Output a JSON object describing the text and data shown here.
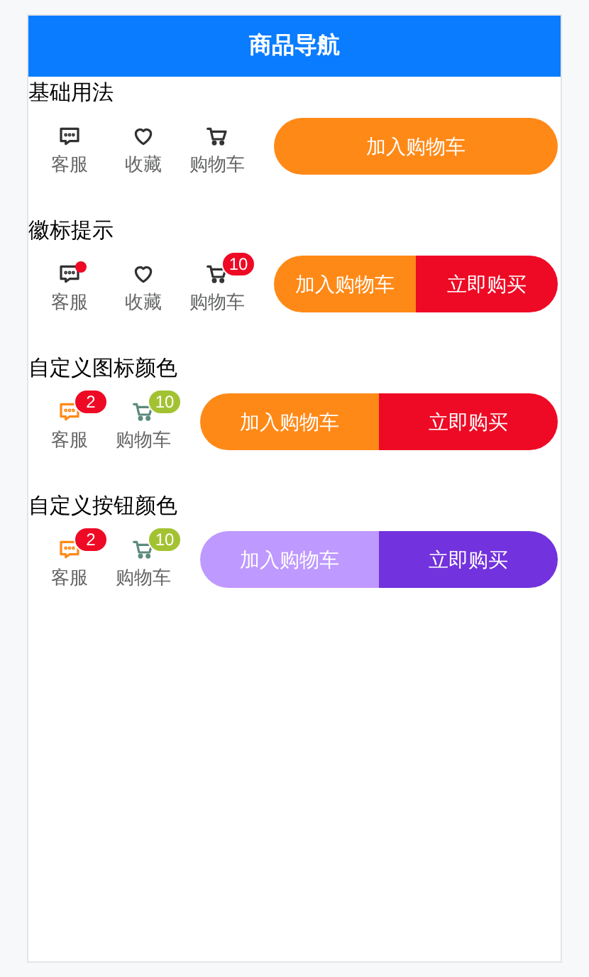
{
  "header": {
    "title": "商品导航"
  },
  "sections": [
    {
      "title": "基础用法",
      "icons": [
        {
          "kind": "chat",
          "label": "客服"
        },
        {
          "kind": "heart",
          "label": "收藏"
        },
        {
          "kind": "cart",
          "label": "购物车"
        }
      ],
      "buttons": [
        {
          "label": "加入购物车",
          "color": "#ff8917"
        }
      ]
    },
    {
      "title": "徽标提示",
      "icons": [
        {
          "kind": "chat",
          "label": "客服",
          "badge": {
            "kind": "dot",
            "color": "#ee0a24"
          }
        },
        {
          "kind": "heart",
          "label": "收藏"
        },
        {
          "kind": "cart",
          "label": "购物车",
          "badge": {
            "kind": "count",
            "text": "10",
            "color": "#ee0a24"
          }
        }
      ],
      "buttons": [
        {
          "label": "加入购物车",
          "color": "#ff8917"
        },
        {
          "label": "立即购买",
          "color": "#ee0a24"
        }
      ]
    },
    {
      "title": "自定义图标颜色",
      "icons": [
        {
          "kind": "chat",
          "label": "客服",
          "color": "#ff8917",
          "badge": {
            "kind": "count",
            "text": "2",
            "color": "#ee0a24"
          }
        },
        {
          "kind": "cart",
          "label": "购物车",
          "color": "#5c8a7e",
          "badge": {
            "kind": "count",
            "text": "10",
            "color": "#a3c232"
          }
        }
      ],
      "buttons": [
        {
          "label": "加入购物车",
          "color": "#ff8917"
        },
        {
          "label": "立即购买",
          "color": "#ee0a24"
        }
      ]
    },
    {
      "title": "自定义按钮颜色",
      "icons": [
        {
          "kind": "chat",
          "label": "客服",
          "color": "#ff8917",
          "badge": {
            "kind": "count",
            "text": "2",
            "color": "#ee0a24"
          }
        },
        {
          "kind": "cart",
          "label": "购物车",
          "color": "#5c8a7e",
          "badge": {
            "kind": "count",
            "text": "10",
            "color": "#a3c232"
          }
        }
      ],
      "buttons": [
        {
          "label": "加入购物车",
          "color": "#be99ff"
        },
        {
          "label": "立即购买",
          "color": "#7232dd"
        }
      ]
    }
  ]
}
